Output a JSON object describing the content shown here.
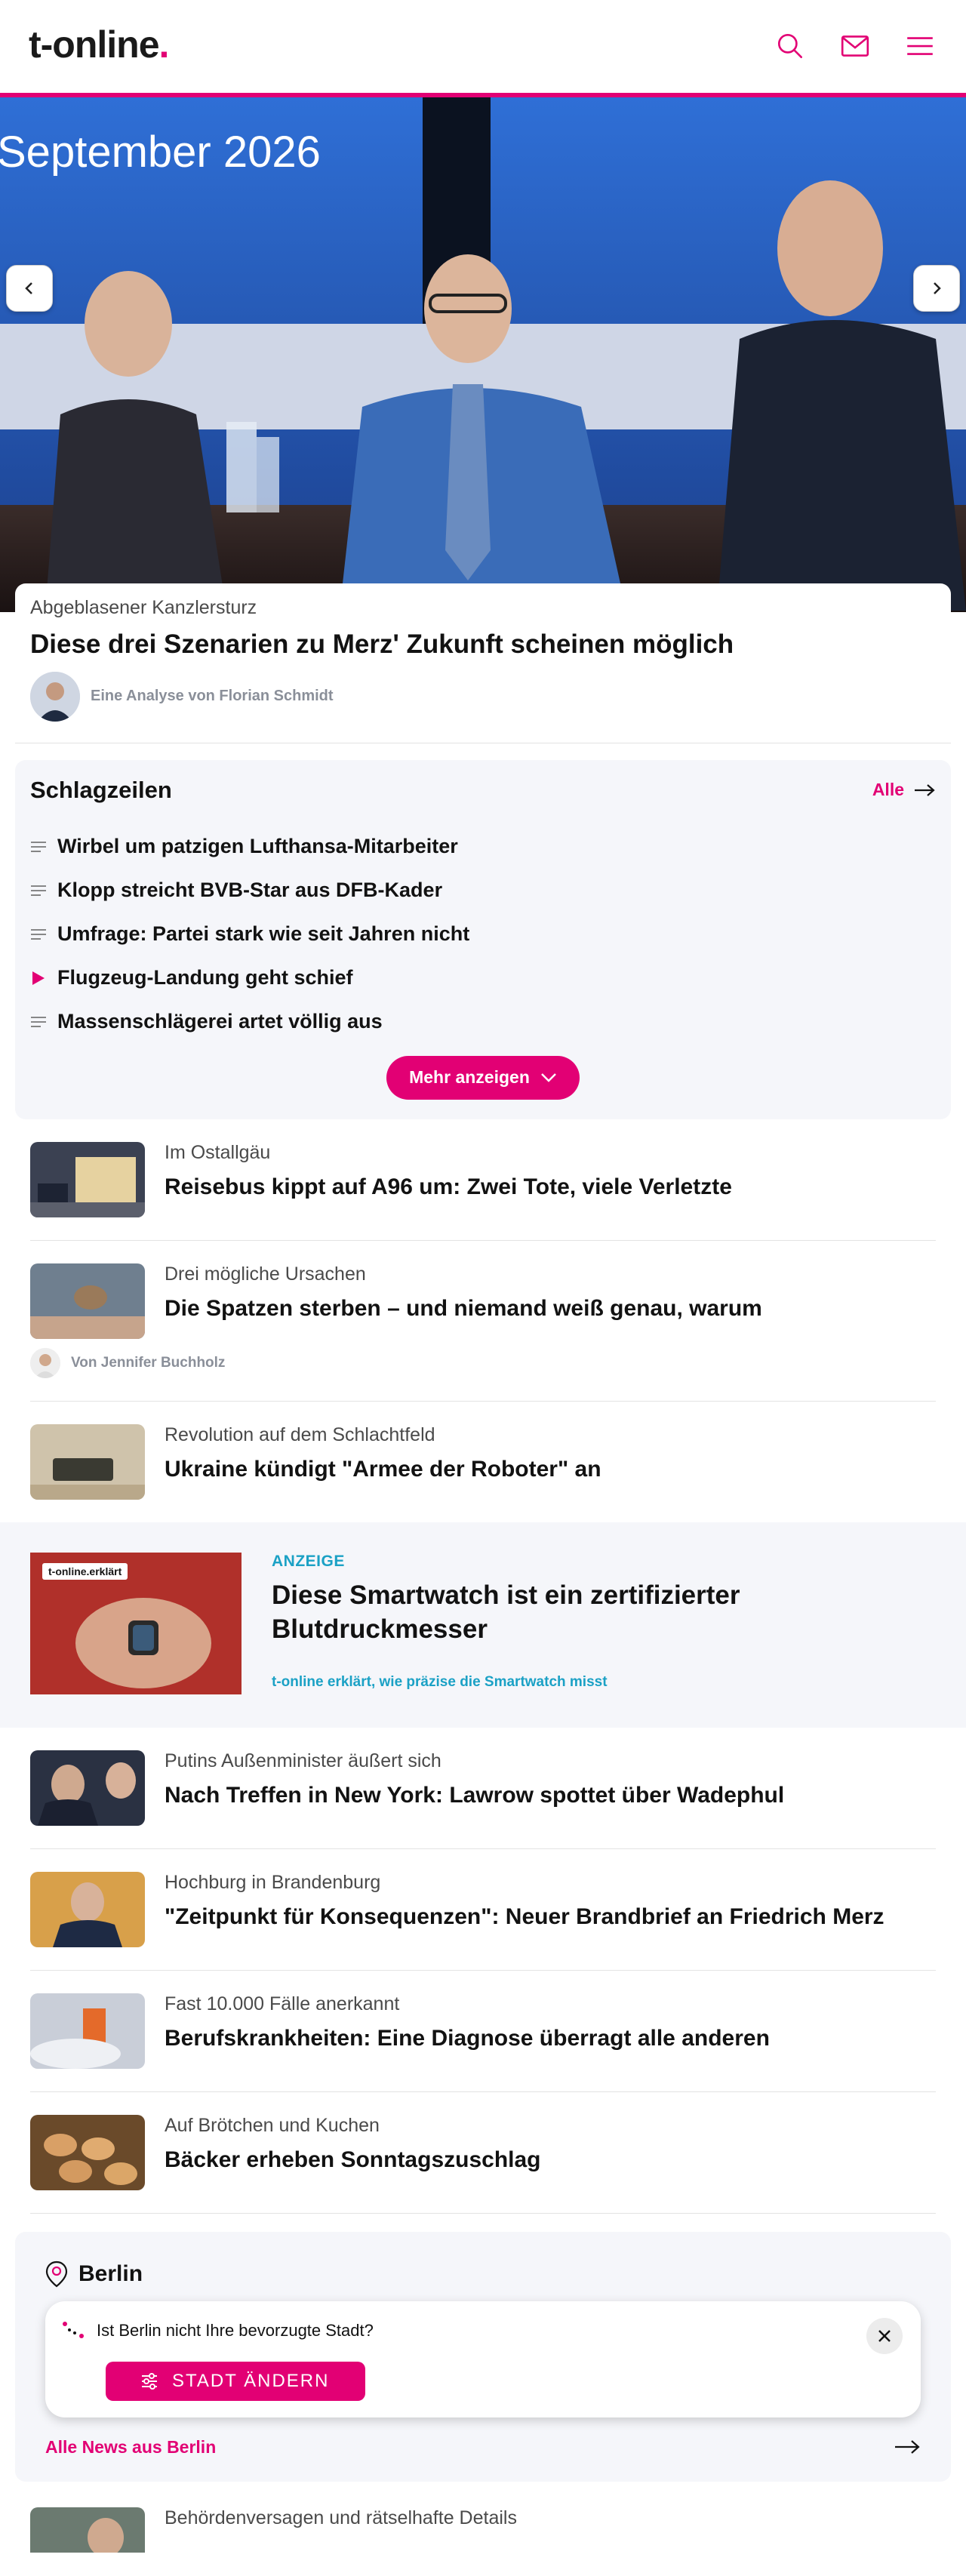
{
  "header": {
    "logo_text": "t-online",
    "logo_dot": ".",
    "icons": [
      "search-icon",
      "mail-icon",
      "menu-icon"
    ],
    "accent": "#e20074"
  },
  "hero": {
    "banner_text": "September 2026",
    "slides_total": 9,
    "active_slide": 1,
    "active_progress": 0.55
  },
  "lead": {
    "kicker": "Abgeblasener Kanzlersturz",
    "title": "Diese drei Szenarien zu Merz' Zukunft scheinen möglich",
    "byline": "Eine Analyse von Florian Schmidt"
  },
  "headlines": {
    "title": "Schlagzeilen",
    "all_label": "Alle",
    "items": [
      {
        "label": "Wirbel um patzigen Lufthansa-Mitarbeiter",
        "icon": "text-lines-icon"
      },
      {
        "label": "Klopp streicht BVB-Star aus DFB-Kader",
        "icon": "text-lines-icon"
      },
      {
        "label": "Umfrage: Partei stark wie seit Jahren nicht",
        "icon": "text-lines-icon"
      },
      {
        "label": "Flugzeug-Landung geht schief",
        "icon": "play-icon"
      },
      {
        "label": "Massenschlägerei artet völlig aus",
        "icon": "text-lines-icon"
      }
    ],
    "more_label": "Mehr anzeigen"
  },
  "news_a": [
    {
      "kicker": "Im Ostallgäu",
      "title": "Reisebus kippt auf A96 um: Zwei Tote, viele Verletzte"
    },
    {
      "kicker": "Drei mögliche Ursachen",
      "title": "Die Spatzen sterben – und niemand weiß genau, warum",
      "byline": "Von Jennifer Buchholz"
    },
    {
      "kicker": "Revolution auf dem Schlachtfeld",
      "title": "Ukraine kündigt \"Armee der Roboter\" an"
    }
  ],
  "ad": {
    "tag_brand": "t-online",
    "tag_suffix": ".erklärt",
    "label": "ANZEIGE",
    "title": "Diese Smartwatch ist ein zertifizierter Blutdruckmesser",
    "subtitle": "t-online erklärt, wie präzise die Smartwatch misst"
  },
  "news_b": [
    {
      "kicker": "Putins Außenminister äußert sich",
      "title": "Nach Treffen in New York: Lawrow spottet über Wadephul"
    },
    {
      "kicker": "Hochburg in Brandenburg",
      "title": "\"Zeitpunkt für Konsequenzen\": Neuer Brandbrief an Friedrich Merz"
    },
    {
      "kicker": "Fast 10.000 Fälle anerkannt",
      "title": "Berufskrankheiten: Eine Diagnose überragt alle anderen"
    },
    {
      "kicker": "Auf Brötchen und Kuchen",
      "title": "Bäcker erheben Sonntagszuschlag"
    }
  ],
  "city": {
    "name": "Berlin",
    "question": "Ist Berlin nicht Ihre bevorzugte Stadt?",
    "change_label": "STADT ÄNDERN",
    "all_news": "Alle News aus Berlin"
  },
  "partial": {
    "kicker": "Behördenversagen und rätselhafte Details"
  }
}
